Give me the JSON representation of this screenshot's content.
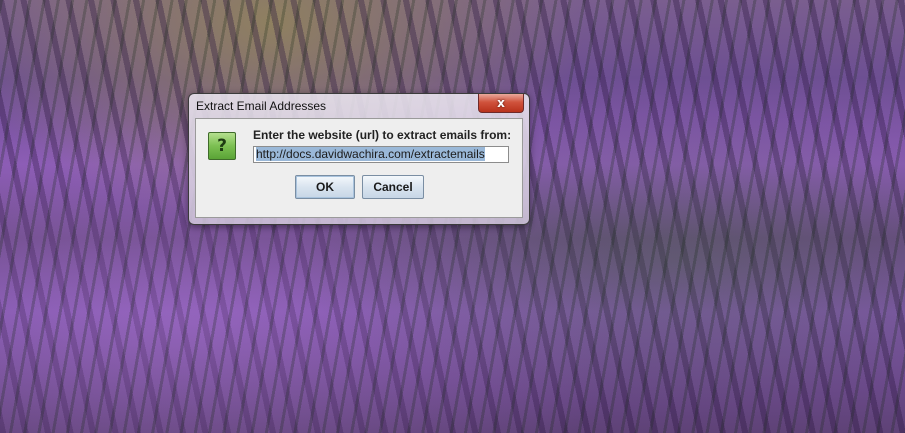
{
  "dialog": {
    "title": "Extract Email Addresses",
    "close_icon_glyph": "x",
    "icon": "question-icon",
    "icon_glyph": "?",
    "prompt": "Enter the website (url) to extract emails from:",
    "url_value": "http://docs.davidwachira.com/extractemails",
    "ok_label": "OK",
    "cancel_label": "Cancel"
  },
  "colors": {
    "icon_green": "#7cbf52",
    "close_red": "#d0533d",
    "selection": "#9ab8d8"
  }
}
